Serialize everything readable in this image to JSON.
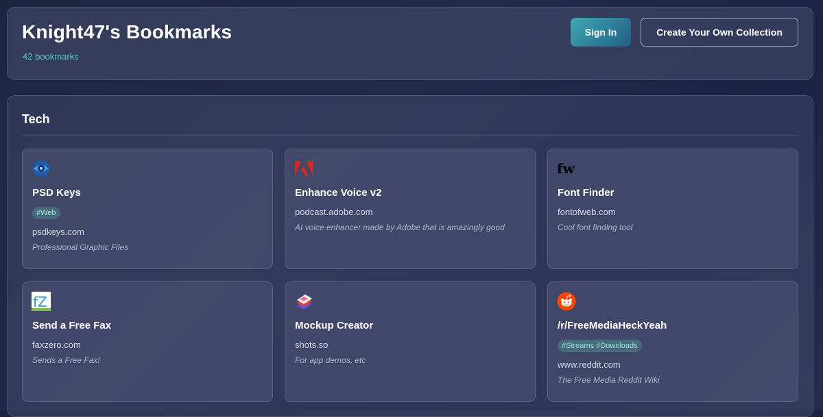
{
  "header": {
    "title": "Knight47's Bookmarks",
    "count": "42 bookmarks",
    "signin_label": "Sign In",
    "create_label": "Create Your Own Collection"
  },
  "section": {
    "title": "Tech",
    "cards": [
      {
        "title": "PSD Keys",
        "tag": "#Web",
        "domain": "psdkeys.com",
        "description": "Professional Graphic Files",
        "icon": "psdkeys-eye-icon"
      },
      {
        "title": "Enhance Voice v2",
        "tag": "",
        "domain": "podcast.adobe.com",
        "description": "AI voice enhancer made by Adobe that is amazingly good",
        "icon": "adobe-icon"
      },
      {
        "title": "Font Finder",
        "tag": "",
        "domain": "fontofweb.com",
        "description": "Cool font finding tool",
        "icon": "fontofweb-icon"
      },
      {
        "title": "Send a Free Fax",
        "tag": "",
        "domain": "faxzero.com",
        "description": "Sends a Free Fax!",
        "icon": "faxzero-icon"
      },
      {
        "title": "Mockup Creator",
        "tag": "",
        "domain": "shots.so",
        "description": "For app demos, etc",
        "icon": "shots-icon"
      },
      {
        "title": "/r/FreeMediaHeckYeah",
        "tag": "#Streams #Downloads",
        "domain": "www.reddit.com",
        "description": "The Free Media Reddit Wiki",
        "icon": "reddit-icon"
      }
    ]
  },
  "colors": {
    "accent": "#5ec7c0",
    "signin_gradient_start": "#3fa9b2",
    "signin_gradient_end": "#275f85"
  }
}
